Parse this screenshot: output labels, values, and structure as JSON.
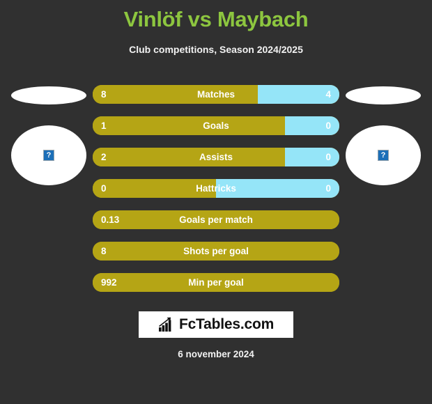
{
  "header": {
    "title": "Vinlöf vs Maybach",
    "subtitle": "Club competitions, Season 2024/2025"
  },
  "colors": {
    "background": "#303030",
    "title_green": "#8DC63F",
    "home_gold": "#B5A515",
    "away_blue": "#95E5F8",
    "text_white": "#ffffff",
    "logo_background": "#ffffff"
  },
  "players": {
    "home": {
      "photo_alt": "?",
      "badge_alt": ""
    },
    "away": {
      "photo_alt": "?",
      "badge_alt": ""
    }
  },
  "stats": [
    {
      "label": "Matches",
      "home": "8",
      "away": "4",
      "home_percent": 67,
      "has_away": true
    },
    {
      "label": "Goals",
      "home": "1",
      "away": "0",
      "home_percent": 78,
      "has_away": true
    },
    {
      "label": "Assists",
      "home": "2",
      "away": "0",
      "home_percent": 78,
      "has_away": true
    },
    {
      "label": "Hattricks",
      "home": "0",
      "away": "0",
      "home_percent": 50,
      "has_away": true
    },
    {
      "label": "Goals per match",
      "home": "0.13",
      "away": "",
      "home_percent": 100,
      "has_away": false
    },
    {
      "label": "Shots per goal",
      "home": "8",
      "away": "",
      "home_percent": 100,
      "has_away": false
    },
    {
      "label": "Min per goal",
      "home": "992",
      "away": "",
      "home_percent": 100,
      "has_away": false
    }
  ],
  "footer": {
    "logo_text": "FcTables.com",
    "logo_icon": "bar-chart-growth-icon",
    "date": "6 november 2024"
  }
}
